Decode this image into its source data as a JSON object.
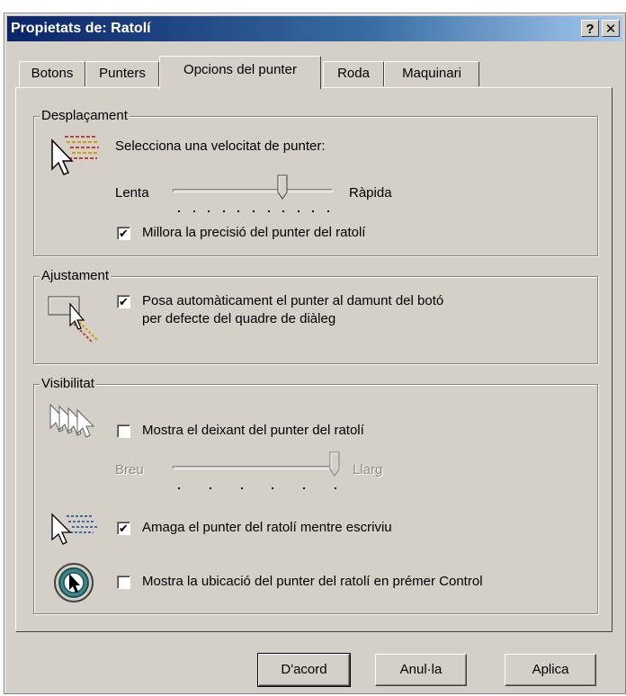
{
  "window": {
    "title": "Propietats de: Ratolí",
    "help_label": "?",
    "close_label": "✕"
  },
  "tabs": [
    {
      "label": "Botons",
      "active": false
    },
    {
      "label": "Punters",
      "active": false
    },
    {
      "label": "Opcions del punter",
      "active": true
    },
    {
      "label": "Roda",
      "active": false
    },
    {
      "label": "Maquinari",
      "active": false
    }
  ],
  "motion": {
    "legend": "Desplaçament",
    "icon": "pointer-speed-icon",
    "prompt": "Selecciona una velocitat de punter:",
    "slow_label": "Lenta",
    "fast_label": "Ràpida",
    "speed_level": 0.7,
    "precision_label": "Millora la precisió del punter del ratolí",
    "precision_checked": true
  },
  "snap": {
    "legend": "Ajustament",
    "icon": "snap-to-button-icon",
    "label": "Posa automàticament el punter al damunt del botó per defecte del quadre de diàleg",
    "label_line1": "Posa automàticament el punter al damunt del botó",
    "label_line2": "per defecte del quadre de diàleg",
    "checked": true
  },
  "visibility": {
    "legend": "Visibilitat",
    "trails_icon": "pointer-trails-icon",
    "trails_label": "Mostra el deixant del punter del ratolí",
    "trails_checked": false,
    "short_label": "Breu",
    "long_label": "Llarg",
    "trails_level": 1.0,
    "hide_icon": "hide-pointer-icon",
    "hide_label": "Amaga el punter del ratolí mentre escriviu",
    "hide_checked": true,
    "locate_icon": "locate-pointer-icon",
    "locate_label": "Mostra la ubicació del punter del ratolí en prémer Control",
    "locate_checked": false
  },
  "buttons": {
    "ok": "D'acord",
    "cancel": "Anul·la",
    "apply": "Aplica"
  },
  "check_glyph": "✔"
}
